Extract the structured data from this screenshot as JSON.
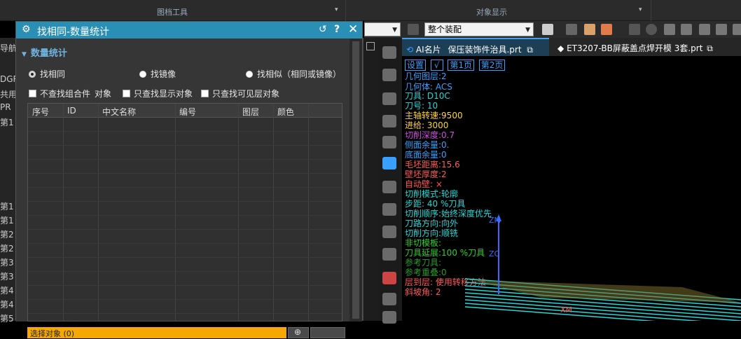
{
  "topbar": {
    "group1": "图档工具",
    "group2": "对象显示"
  },
  "toolbar": {
    "combo1_value": "",
    "assembly_value": "整个装配"
  },
  "left_panel_lines": [
    "导航器",
    "DGRA",
    "共用项",
    "PR",
    "第1",
    "第1",
    "第1",
    "第2",
    "第2",
    "第3",
    "第3",
    "第4",
    "第4",
    "第5"
  ],
  "dialog": {
    "title": "找相同-数量统计",
    "section": "数量统计",
    "radios": [
      "找相同",
      "找镜像",
      "找相似（相同或镜像）"
    ],
    "checks": [
      "不查找组合件",
      "对象",
      "只查找显示对象",
      "只查找可见层对象"
    ],
    "columns": [
      "序号",
      "ID",
      "中文名称",
      "编号",
      "图层",
      "颜色"
    ]
  },
  "tabs": [
    {
      "label": "AI名片"
    },
    {
      "label": "保压装饰件治具.prt"
    },
    {
      "label": "ET3207-BB屏蔽盖点焊开模 3套.prt"
    }
  ],
  "viewport_lines": [
    {
      "text": "设置",
      "color": "#3aa0ff"
    },
    {
      "text": "几何图层:2",
      "color": "#3aa0ff"
    },
    {
      "text": "几何体:   ACS",
      "color": "#3aa0ff"
    },
    {
      "text": "刀具:     D10C",
      "color": "#23d8d8"
    },
    {
      "text": "刀号:     10",
      "color": "#23d8d8"
    },
    {
      "text": "主轴转速:9500",
      "color": "#ffd42a"
    },
    {
      "text": "进给:     3000",
      "color": "#ffd42a"
    },
    {
      "text": "切削深度:0.7",
      "color": "#d24be0"
    },
    {
      "text": "侧面余量:0.",
      "color": "#3aa0ff"
    },
    {
      "text": "底面余量:0",
      "color": "#3aa0ff"
    },
    {
      "text": "毛坯距离:15.6",
      "color": "#ff5a5a"
    },
    {
      "text": "壁坯厚度:2",
      "color": "#ff5a5a"
    },
    {
      "text": "自动壁:  ×",
      "color": "#ff5a5a"
    },
    {
      "text": "切削模式:轮廓",
      "color": "#23d8d8"
    },
    {
      "text": "步距:     40  %刀具",
      "color": "#23d8d8"
    },
    {
      "text": "切削顺序:始终深度优先",
      "color": "#23d8d8"
    },
    {
      "text": "刀路方向:向外",
      "color": "#23d8d8"
    },
    {
      "text": "切削方向:顺铣",
      "color": "#23d8d8"
    },
    {
      "text": "非切模板:",
      "color": "#2bd12b"
    },
    {
      "text": "刀具延展:100 %刀具",
      "color": "#2bd12b"
    },
    {
      "text": "参考刀具:",
      "color": "#2a9a2a"
    },
    {
      "text": "参考重叠:0",
      "color": "#2a9a2a"
    },
    {
      "text": "层到层:    使用转移方法",
      "color": "#ff5a5a"
    },
    {
      "text": "斜坡角:   2",
      "color": "#ff5a5a"
    }
  ],
  "viewport_header": {
    "page1": "第1页",
    "page2": "第2页",
    "check": "√"
  },
  "axes": {
    "zm": "ZM",
    "zc": "ZC",
    "xm": "XM"
  },
  "footer_text": "选择对象 (0)",
  "colors": {
    "title_bar": "#2a8fb5",
    "accent": "#f5a800"
  }
}
